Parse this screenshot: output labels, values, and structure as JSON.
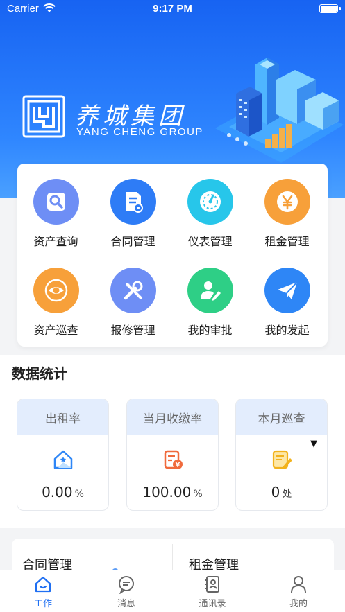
{
  "status_bar": {
    "carrier": "Carrier",
    "time": "9:17 PM"
  },
  "brand": {
    "name_cn": "养城集团",
    "name_en": "YANG CHENG GROUP"
  },
  "functions": [
    {
      "label": "资产查询",
      "icon": "search-doc-icon",
      "color": "#6e8ef5"
    },
    {
      "label": "合同管理",
      "icon": "contract-icon",
      "color": "#2e7cf6"
    },
    {
      "label": "仪表管理",
      "icon": "meter-icon",
      "color": "#27c6ea"
    },
    {
      "label": "租金管理",
      "icon": "yen-icon",
      "color": "#f7a03a"
    },
    {
      "label": "资产巡查",
      "icon": "eye-icon",
      "color": "#f7a03a"
    },
    {
      "label": "报修管理",
      "icon": "tools-icon",
      "color": "#6e8ef5"
    },
    {
      "label": "我的审批",
      "icon": "approval-icon",
      "color": "#2ecf86"
    },
    {
      "label": "我的发起",
      "icon": "paper-plane-icon",
      "color": "#2e86f6"
    }
  ],
  "section_title": "数据统计",
  "stats": [
    {
      "title": "出租率",
      "value": "0.00",
      "unit": "%"
    },
    {
      "title": "当月收缴率",
      "value": "100.00",
      "unit": "%"
    },
    {
      "title": "本月巡查",
      "value": "0",
      "unit": "处"
    }
  ],
  "modules": [
    {
      "title": "合同管理"
    },
    {
      "title": "租金管理"
    }
  ],
  "tabs": [
    {
      "label": "工作",
      "icon": "home-icon",
      "active": true
    },
    {
      "label": "消息",
      "icon": "message-icon",
      "active": false
    },
    {
      "label": "通讯录",
      "icon": "contacts-icon",
      "active": false
    },
    {
      "label": "我的",
      "icon": "profile-icon",
      "active": false
    }
  ],
  "colors": {
    "primary": "#1f6ff2",
    "banner_top": "#1763f2",
    "stat_header": "#e3edfd"
  }
}
